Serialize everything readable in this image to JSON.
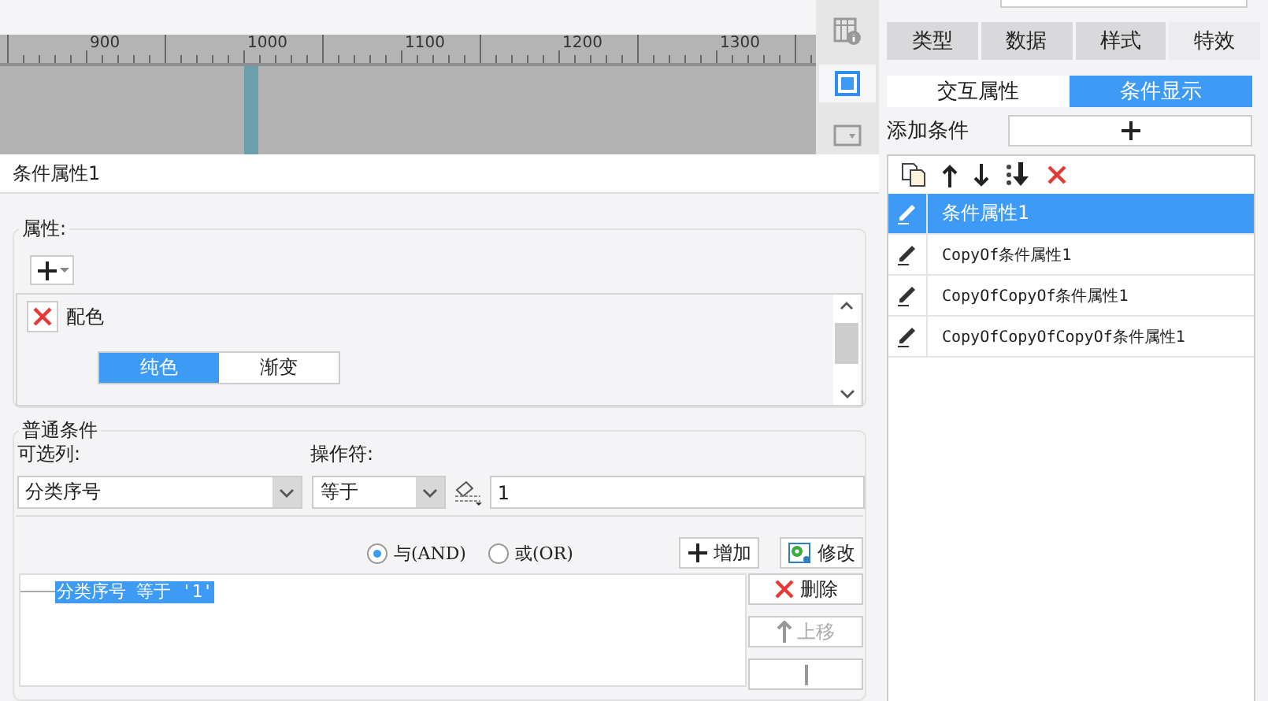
{
  "ruler": {
    "labels": [
      "900",
      "1000",
      "1100",
      "1200",
      "1300"
    ]
  },
  "side_toolbar": [
    {
      "kind": "info",
      "selected": false
    },
    {
      "kind": "frame",
      "selected": true
    },
    {
      "kind": "dropdown",
      "selected": false
    }
  ],
  "property_title": "条件属性1",
  "attributes": {
    "legend": "属性:",
    "items": [
      {
        "name": "配色",
        "segments": [
          {
            "label": "纯色",
            "selected": true
          },
          {
            "label": "渐变",
            "selected": false
          }
        ]
      }
    ]
  },
  "condition": {
    "legend": "普通条件",
    "column_label": "可选列:",
    "column_value": "分类序号",
    "operator_label": "操作符:",
    "operator_value": "等于",
    "value": "1",
    "logic": [
      {
        "label": "与(AND)",
        "selected": true
      },
      {
        "label": "或(OR)",
        "selected": false
      }
    ],
    "add_button": "增加",
    "modify_button": "修改",
    "entries": [
      {
        "text": "分类序号 等于 '1'",
        "selected": true
      }
    ],
    "side_buttons": [
      {
        "kind": "delete",
        "label": "删除",
        "disabled": false
      },
      {
        "kind": "up",
        "label": "上移",
        "disabled": true
      },
      {
        "kind": "down",
        "disabled": true
      }
    ]
  },
  "panel": {
    "tabs": [
      {
        "label": "类型",
        "selected": false
      },
      {
        "label": "数据",
        "selected": false
      },
      {
        "label": "样式",
        "selected": false
      },
      {
        "label": "特效",
        "selected": true
      }
    ],
    "subtabs": [
      {
        "label": "交互属性",
        "selected": false
      },
      {
        "label": "条件显示",
        "selected": true
      }
    ],
    "add_label": "添加条件",
    "conditions": [
      {
        "name": "条件属性1",
        "selected": true
      },
      {
        "name": "CopyOf条件属性1",
        "selected": false
      },
      {
        "name": "CopyOfCopyOf条件属性1",
        "selected": false
      },
      {
        "name": "CopyOfCopyOfCopyOf条件属性1",
        "selected": false
      }
    ]
  }
}
